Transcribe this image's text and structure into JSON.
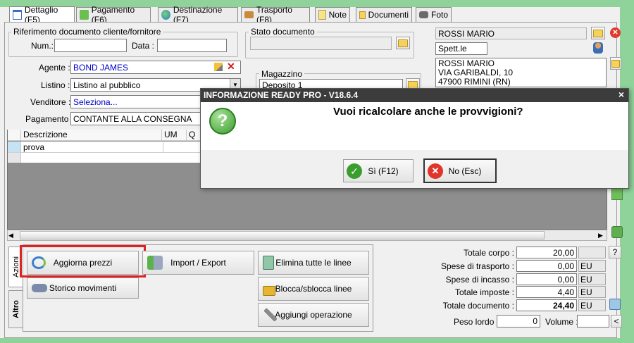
{
  "tabs": [
    {
      "label": "Dettaglio (F5)",
      "icon": "calendar-icon"
    },
    {
      "label": "Pagamento (F6)",
      "icon": "money-icon"
    },
    {
      "label": "Destinazione (F7)",
      "icon": "globe-icon"
    },
    {
      "label": "Trasporto (F8)",
      "icon": "truck-icon"
    },
    {
      "label": "Note",
      "icon": "note-icon"
    },
    {
      "label": "Documenti",
      "icon": "documents-icon"
    },
    {
      "label": "Foto",
      "icon": "camera-icon"
    }
  ],
  "riferimento": {
    "title": "Riferimento documento cliente/fornitore",
    "num_label": "Num.:",
    "num_value": "",
    "data_label": "Data :",
    "data_value": ""
  },
  "stato": {
    "title": "Stato documento",
    "value": ""
  },
  "magazzino": {
    "title": "Magazzino",
    "value": "Deposito 1"
  },
  "form": {
    "agente_label": "Agente :",
    "agente_value": "BOND JAMES",
    "listino_label": "Listino :",
    "listino_value": "Listino al pubblico",
    "venditore_label": "Venditore :",
    "venditore_value": "Seleziona...",
    "pagamento_label": "Pagamento :",
    "pagamento_value": "CONTANTE ALLA CONSEGNA"
  },
  "cliente": {
    "name": "ROSSI MARIO",
    "title": "Spett.le",
    "address_lines": [
      "ROSSI MARIO",
      "VIA GARIBALDI, 10",
      "47900 RIMINI (RN)"
    ]
  },
  "grid": {
    "columns": [
      "Descrizione",
      "UM",
      "Q"
    ],
    "rows": [
      {
        "descrizione": "prova",
        "um": "",
        "q": ""
      }
    ]
  },
  "dialog": {
    "title": "INFORMAZIONE READY PRO - V18.6.4",
    "message": "Vuoi ricalcolare anche le provvigioni?",
    "yes_label": "Sì (F12)",
    "no_label": "No (Esc)",
    "close": "×"
  },
  "side_tabs": {
    "azioni": "Azioni",
    "altro": "Altro"
  },
  "actions": {
    "aggiorna_prezzi": "Aggiorna prezzi",
    "import_export": "Import / Export",
    "elimina_linee": "Elimina tutte le linee",
    "storico_movimenti": "Storico movimenti",
    "blocca_sblocca": "Blocca/sblocca linee",
    "aggiungi_operazione": "Aggiungi operazione"
  },
  "totals": {
    "corpo_label": "Totale corpo :",
    "corpo_value": "20,00",
    "trasporto_label": "Spese di trasporto :",
    "trasporto_value": "0,00",
    "trasporto_currency": "EU",
    "incasso_label": "Spese di incasso :",
    "incasso_value": "0,00",
    "incasso_currency": "EU",
    "imposte_label": "Totale imposte :",
    "imposte_value": "4,40",
    "imposte_currency": "EU",
    "documento_label": "Totale documento :",
    "documento_value": "24,40",
    "documento_currency": "EU",
    "peso_label": "Peso lordo :",
    "peso_value": "0",
    "volume_label": "Volume :",
    "volume_value": "",
    "help_button": "?",
    "volume_button": "<"
  },
  "colors": {
    "highlight": "#e02020",
    "dialog_title": "#3c3c3c",
    "accent_blue": "#0000cc"
  }
}
